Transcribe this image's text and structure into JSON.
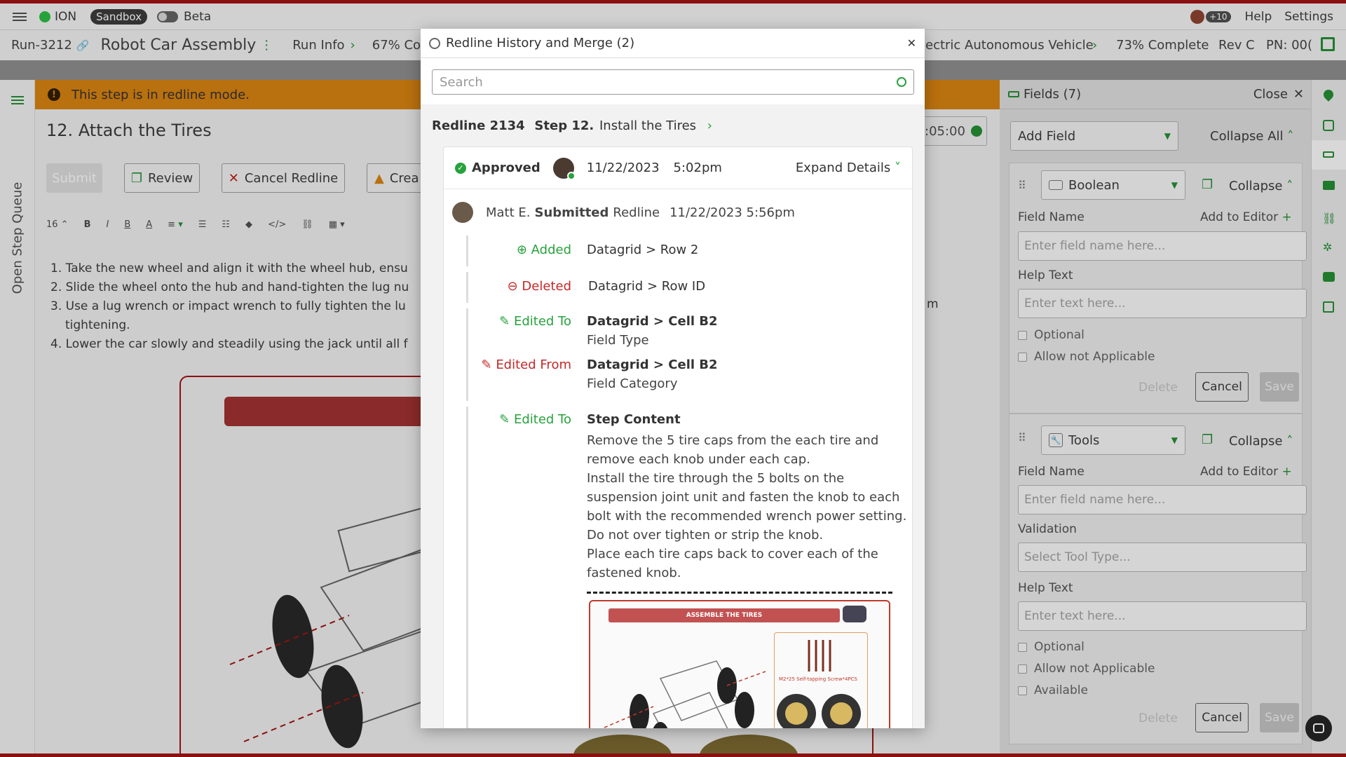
{
  "topbar": {
    "brand": "ION",
    "sandbox": "Sandbox",
    "beta": "Beta",
    "avatar_count": "+10",
    "help": "Help",
    "settings": "Settings"
  },
  "runbar": {
    "run_id": "Run-3212",
    "title": "Robot Car Assembly",
    "run_info": "Run Info",
    "progress_left": "67% Com",
    "vehicle": "ectric Autonomous Vehicle",
    "complete": "73% Complete",
    "rev": "Rev C",
    "pn": "PN: 00("
  },
  "left_rail": {
    "label": "Open Step Queue"
  },
  "editor": {
    "banner": "This step is in redline mode.",
    "step_title": "12. Attach the Tires",
    "timer": ":05:00",
    "buttons": {
      "submit": "Submit",
      "review": "Review",
      "cancel_redline": "Cancel Redline",
      "create": "Crea"
    },
    "font_size": "16",
    "steps": [
      "1. Take the new wheel and align it with the wheel hub, ensu",
      "2. Slide the wheel onto the hub and hand-tighten the lug nu",
      "3. Use a lug wrench or impact wrench to fully tighten the lu",
      "tightening.",
      "4. Lower the car slowly and steadily using the jack until all f"
    ],
    "step3_tail": "m"
  },
  "fields_panel": {
    "title": "Fields (7)",
    "close": "Close",
    "add_field": "Add Field",
    "collapse_all": "Collapse All",
    "card1": {
      "type": "Boolean",
      "collapse": "Collapse",
      "field_name_label": "Field Name",
      "add_to_editor": "Add to Editor",
      "field_name_placeholder": "Enter field name here...",
      "help_text_label": "Help Text",
      "help_text_placeholder": "Enter text here...",
      "optional": "Optional",
      "allow_na": "Allow not Applicable",
      "delete": "Delete",
      "cancel": "Cancel",
      "save": "Save"
    },
    "card2": {
      "type": "Tools",
      "collapse": "Collapse",
      "field_name_label": "Field Name",
      "add_to_editor": "Add to Editor",
      "field_name_placeholder": "Enter field name here...",
      "validation_label": "Validation",
      "validation_placeholder": "Select Tool Type...",
      "help_text_label": "Help Text",
      "help_text_placeholder": "Enter text here...",
      "optional": "Optional",
      "allow_na": "Allow not Applicable",
      "available": "Available",
      "delete": "Delete",
      "cancel": "Cancel",
      "save": "Save"
    }
  },
  "modal": {
    "title": "Redline History and Merge (2)",
    "search_placeholder": "Search",
    "redline_id": "Redline 2134",
    "step_label": "Step 12.",
    "step_name": "Install the Tires",
    "status": "Approved",
    "date": "11/22/2023",
    "time": "5:02pm",
    "expand": "Expand Details",
    "submitter": "Matt E.",
    "action": "Submitted",
    "entity": "Redline",
    "submitted_at": "11/22/2023 5:56pm",
    "changes": [
      {
        "kind": "Added",
        "path": "Datagrid > Row 2"
      },
      {
        "kind": "Deleted",
        "path": "Datagrid > Row ID"
      },
      {
        "kind": "Edited To",
        "path": "Datagrid > Cell B2",
        "detail": "Field Type"
      },
      {
        "kind": "Edited From",
        "path": "Datagrid > Cell B2",
        "detail": "Field Category"
      },
      {
        "kind": "Edited To",
        "path": "Step Content"
      }
    ],
    "content_lines": [
      "Remove the 5 tire caps from the each tire and",
      "remove each knob under each cap.",
      "Install the tire through the 5 bolts on the",
      "suspension joint unit and fasten the knob to each",
      "bolt with the recommended wrench power setting.",
      "Do not over tighten or strip the knob.",
      "Place each tire caps back to cover each of the",
      "fastened knob."
    ],
    "image_banner": "ASSEMBLE THE TIRES",
    "image_caption": "M2*25 Self-tapping Screw*4PCS"
  },
  "colors": {
    "approved": "#27a23c",
    "deleted": "#c62828",
    "banner": "#e8950f",
    "topred": "#b01010"
  }
}
